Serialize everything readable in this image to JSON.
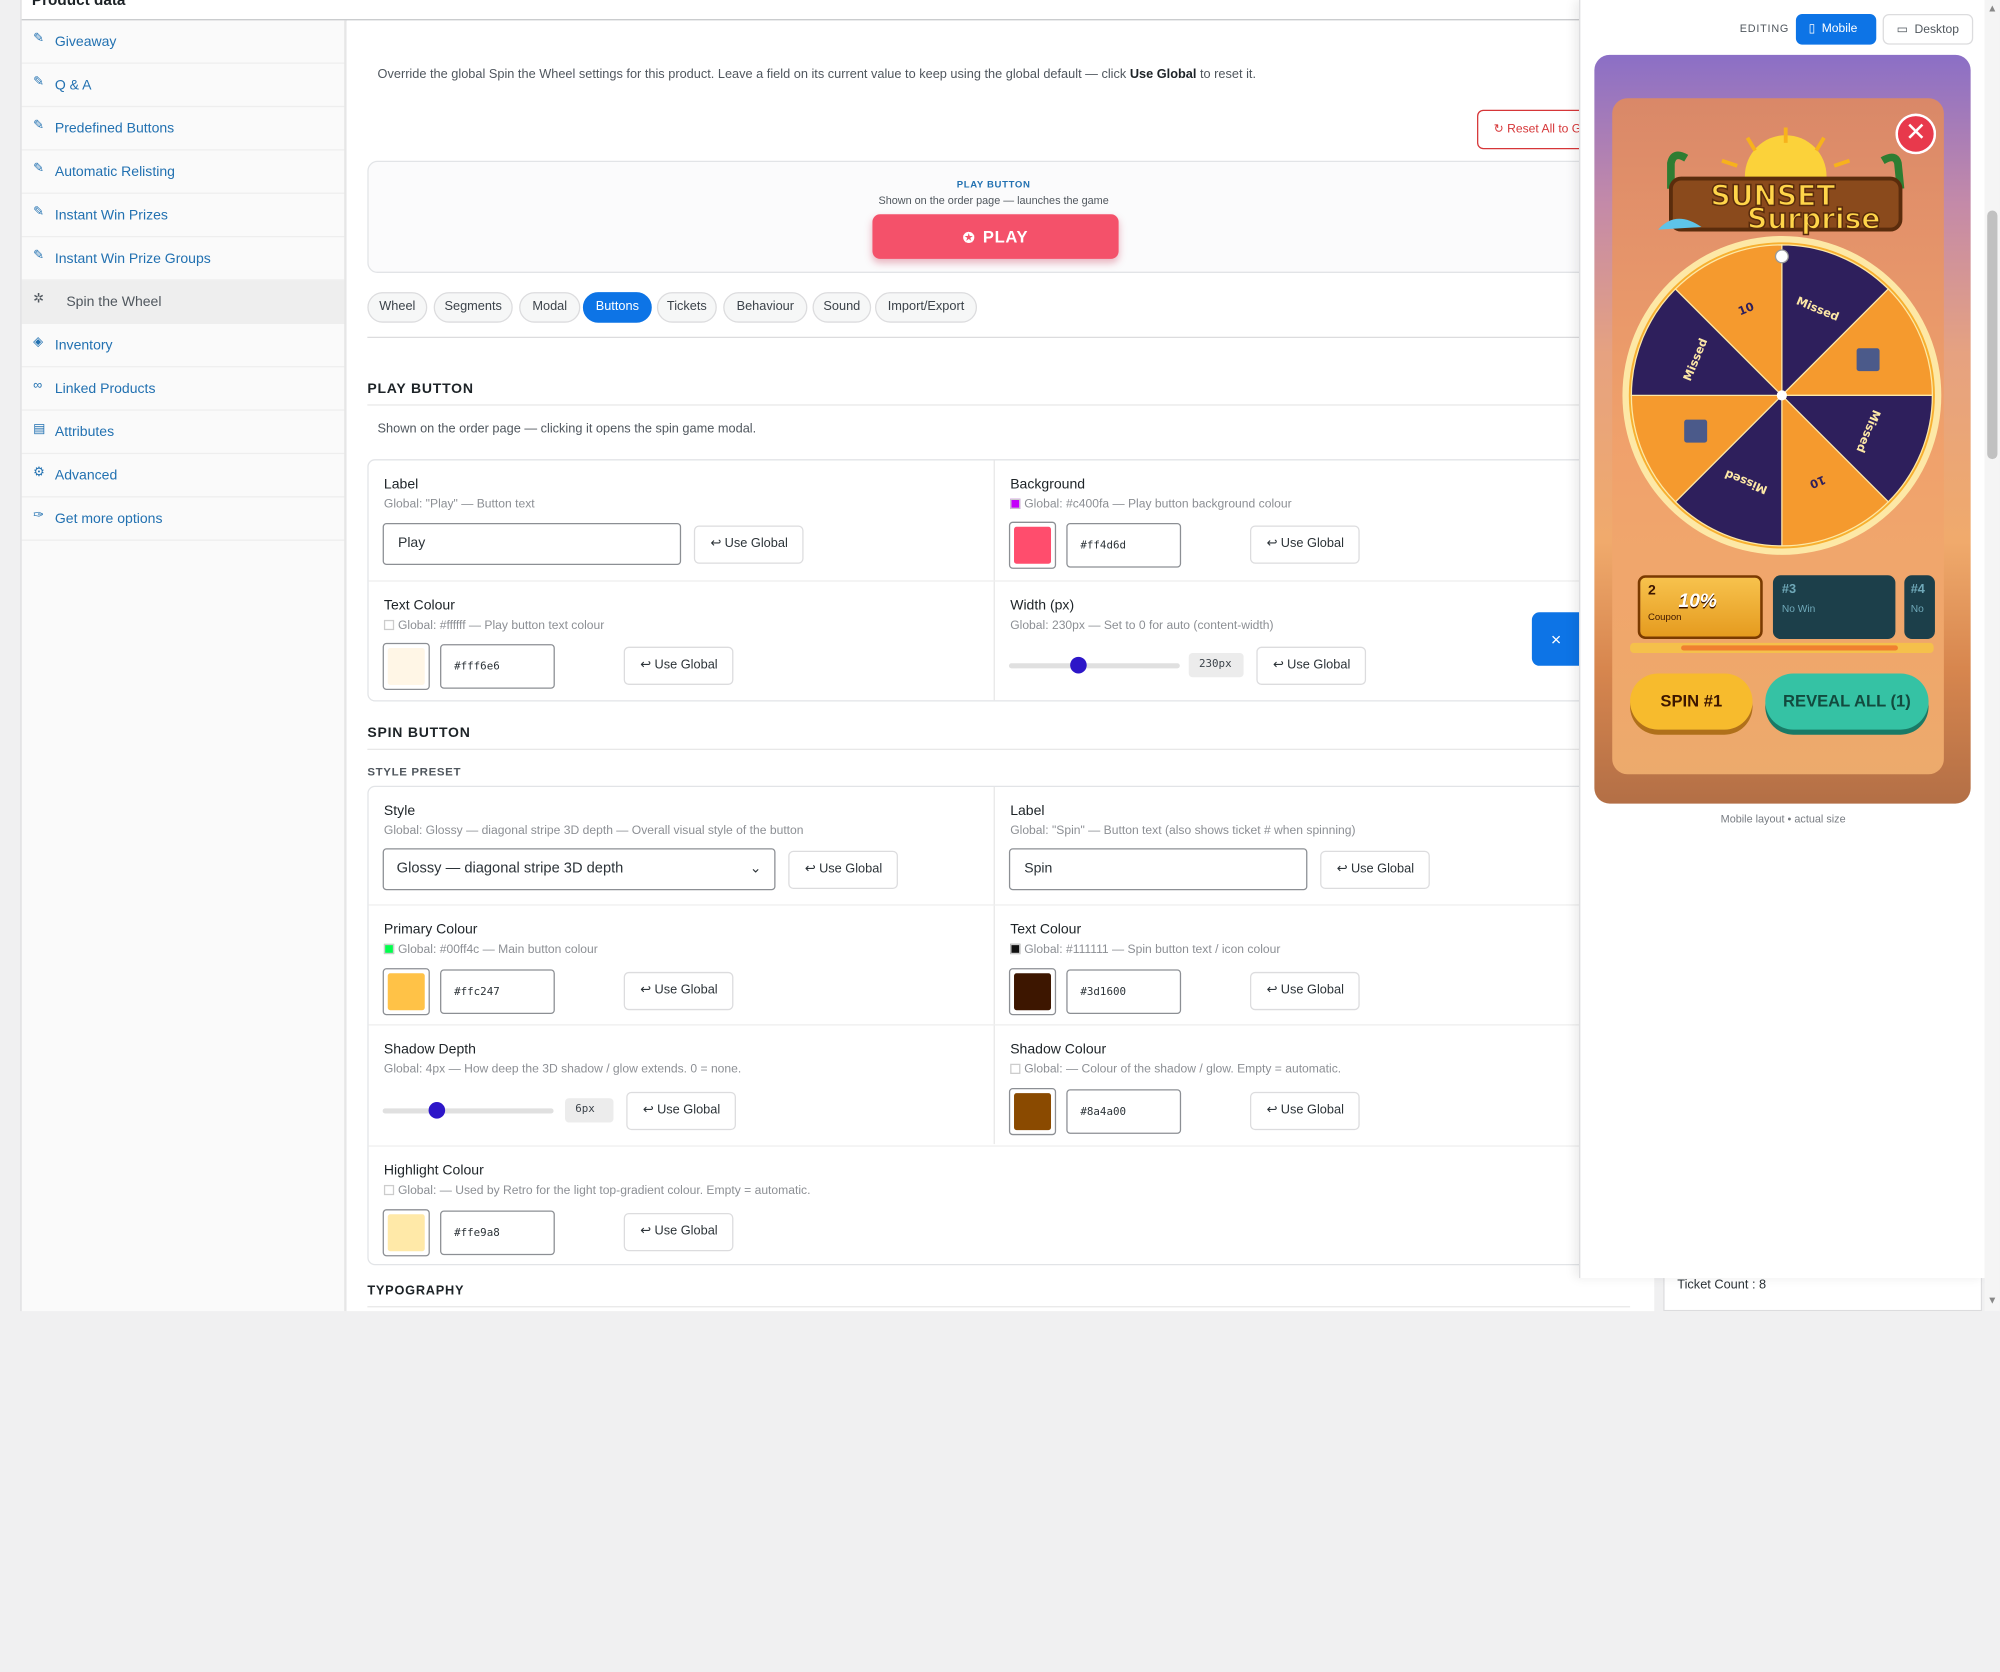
{
  "page_header": {
    "title": "Product data"
  },
  "sidebar": {
    "items": [
      {
        "label": "Giveaway",
        "icon": "wrench-icon"
      },
      {
        "label": "Q & A",
        "icon": "wrench-icon"
      },
      {
        "label": "Predefined Buttons",
        "icon": "wrench-icon"
      },
      {
        "label": "Automatic Relisting",
        "icon": "wrench-icon"
      },
      {
        "label": "Instant Win Prizes",
        "icon": "wrench-icon"
      },
      {
        "label": "Instant Win Prize Groups",
        "icon": "wrench-icon"
      },
      {
        "label": "Spin the Wheel",
        "icon": "wheel-icon"
      },
      {
        "label": "Inventory",
        "icon": "tag-icon"
      },
      {
        "label": "Linked Products",
        "icon": "link-icon"
      },
      {
        "label": "Attributes",
        "icon": "list-icon"
      },
      {
        "label": "Advanced",
        "icon": "gear-icon"
      },
      {
        "label": "Get more options",
        "icon": "plugin-icon"
      }
    ],
    "active_index": 6
  },
  "main": {
    "intro_a": "Override the global Spin the Wheel settings for this product. Leave a field on its current value to keep using the global default — click ",
    "intro_b": "Use Global",
    "intro_c": " to reset it.",
    "reset_all": "↻ Reset All to G",
    "play_preview": {
      "title": "PLAY BUTTON",
      "subtitle": "Shown on the order page — launches the game",
      "button_label": "PLAY"
    },
    "tabs": [
      "Wheel",
      "Segments",
      "Modal",
      "Buttons",
      "Tickets",
      "Behaviour",
      "Sound",
      "Import/Export"
    ],
    "active_tab": "Buttons",
    "use_global": "↩ Use Global",
    "play_section": {
      "title": "PLAY BUTTON",
      "desc": "Shown on the order page — clicking it opens the spin game modal.",
      "label": {
        "name": "Label",
        "global": "Global: \"Play\" — Button text",
        "value": "Play"
      },
      "background": {
        "name": "Background",
        "global": "Global: #c400fa — Play button background colour",
        "global_color": "#c400fa",
        "value": "#ff4d6d"
      },
      "text_colour": {
        "name": "Text Colour",
        "global": "Global: #ffffff — Play button text colour",
        "global_color": "#ffffff",
        "value": "#fff6e6"
      },
      "width": {
        "name": "Width (px)",
        "global": "Global: 230px — Set to 0 for auto (content-width)",
        "value": "230px",
        "level": 0.4
      }
    },
    "spin_section": {
      "title": "SPIN BUTTON",
      "preset_title": "STYLE PRESET",
      "style": {
        "name": "Style",
        "global": "Global: Glossy — diagonal stripe 3D depth — Overall visual style of the button",
        "value": "Glossy — diagonal stripe 3D depth"
      },
      "label": {
        "name": "Label",
        "global": "Global: \"Spin\" — Button text (also shows ticket # when spinning)",
        "value": "Spin"
      },
      "primary": {
        "name": "Primary Colour",
        "global": "Global: #00ff4c — Main button colour",
        "global_color": "#00ff4c",
        "value": "#ffc247"
      },
      "text_colour": {
        "name": "Text Colour",
        "global": "Global: #111111 — Spin button text / icon colour",
        "global_color": "#111111",
        "value": "#3d1600"
      },
      "shadow_depth": {
        "name": "Shadow Depth",
        "global": "Global: 4px — How deep the 3D shadow / glow extends. 0 = none.",
        "value": "6px",
        "level": 0.3
      },
      "shadow_colour": {
        "name": "Shadow Colour",
        "global": "Global: — Colour of the shadow / glow. Empty = automatic.",
        "value": "#8a4a00"
      },
      "highlight": {
        "name": "Highlight Colour",
        "global": "Global: — Used by Retro for the light top-gradient colour. Empty = automatic.",
        "value": "#ffe9a8"
      }
    },
    "typography_title": "TYPOGRAPHY"
  },
  "preview": {
    "editing": "EDITING",
    "mobile": "Mobile",
    "desktop": "Desktop",
    "logo_line1": "SUNSET",
    "logo_line2": "Surprise",
    "segments": [
      "Missed",
      "",
      "Missed",
      "10",
      "Missed",
      "",
      "Missed",
      "10"
    ],
    "tickets": [
      {
        "num": "2",
        "badge": "10%",
        "label": "Coupon"
      },
      {
        "num": "#3",
        "label": "No Win"
      },
      {
        "num": "#4",
        "label": "No"
      }
    ],
    "spin_btn": "SPIN #1",
    "reveal_btn": "REVEAL ALL (1)",
    "caption": "Mobile layout • actual size",
    "fab": "×"
  },
  "side_meta": {
    "ticket_count": "Ticket Count : 8"
  },
  "colors": {
    "accent": "#0d74e6",
    "link": "#2271b1",
    "danger": "#d63638",
    "play": "#f4516a"
  }
}
